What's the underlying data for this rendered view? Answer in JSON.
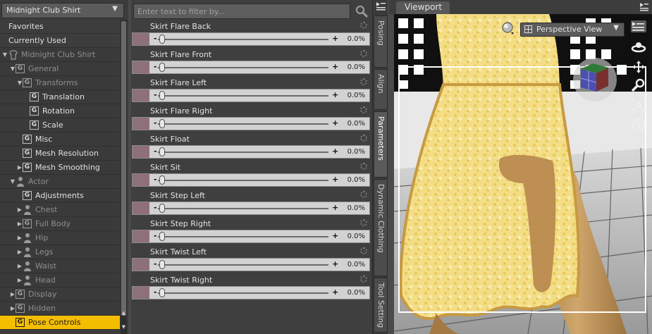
{
  "node_selector": {
    "value": "Midnight Club Shirt"
  },
  "tree": {
    "flat_items": [
      "Favorites",
      "Currently Used"
    ],
    "root": "Midnight Club Shirt",
    "items": [
      {
        "label": "General",
        "depth": 1,
        "icon": "group-icon",
        "expander": "expanded",
        "dim": true
      },
      {
        "label": "Transforms",
        "depth": 2,
        "icon": "group-icon",
        "expander": "expanded",
        "dim": true
      },
      {
        "label": "Translation",
        "depth": 3,
        "icon": "group-icon",
        "expander": "none",
        "dim": false
      },
      {
        "label": "Rotation",
        "depth": 3,
        "icon": "group-icon",
        "expander": "none",
        "dim": false
      },
      {
        "label": "Scale",
        "depth": 3,
        "icon": "group-icon",
        "expander": "none",
        "dim": false
      },
      {
        "label": "Misc",
        "depth": 2,
        "icon": "group-icon",
        "expander": "none",
        "dim": false
      },
      {
        "label": "Mesh Resolution",
        "depth": 2,
        "icon": "group-icon",
        "expander": "none",
        "dim": false
      },
      {
        "label": "Mesh Smoothing",
        "depth": 2,
        "icon": "group-icon",
        "expander": "collapsed",
        "dim": false
      },
      {
        "label": "Actor",
        "depth": 1,
        "icon": "figure-icon",
        "expander": "expanded",
        "dim": true
      },
      {
        "label": "Adjustments",
        "depth": 2,
        "icon": "group-icon",
        "expander": "none",
        "dim": false
      },
      {
        "label": "Chest",
        "depth": 2,
        "icon": "figure-icon",
        "expander": "collapsed",
        "dim": true
      },
      {
        "label": "Full Body",
        "depth": 2,
        "icon": "group-icon",
        "expander": "collapsed",
        "dim": true
      },
      {
        "label": "Hip",
        "depth": 2,
        "icon": "figure-icon",
        "expander": "collapsed",
        "dim": true
      },
      {
        "label": "Legs",
        "depth": 2,
        "icon": "figure-icon",
        "expander": "collapsed",
        "dim": true
      },
      {
        "label": "Waist",
        "depth": 2,
        "icon": "figure-icon",
        "expander": "collapsed",
        "dim": true
      },
      {
        "label": "Head",
        "depth": 2,
        "icon": "figure-icon",
        "expander": "collapsed",
        "dim": true
      },
      {
        "label": "Display",
        "depth": 1,
        "icon": "group-icon",
        "expander": "collapsed",
        "dim": true
      },
      {
        "label": "Hidden",
        "depth": 1,
        "icon": "group-icon",
        "expander": "collapsed",
        "dim": true
      },
      {
        "label": "Pose Controls",
        "depth": 1,
        "icon": "group-icon",
        "expander": "none",
        "dim": false,
        "selected": true
      }
    ]
  },
  "filter": {
    "placeholder": "Enter text to filter by..."
  },
  "parameters": [
    {
      "name": "Skirt Flare Back",
      "value": "0.0%",
      "minus": "-",
      "plus": "+"
    },
    {
      "name": "Skirt Flare Front",
      "value": "0.0%",
      "minus": "-",
      "plus": "+"
    },
    {
      "name": "Skirt Flare Left",
      "value": "0.0%",
      "minus": "-",
      "plus": "+"
    },
    {
      "name": "Skirt Flare Right",
      "value": "0.0%",
      "minus": "-",
      "plus": "+"
    },
    {
      "name": "Skirt Float",
      "value": "0.0%",
      "minus": "-",
      "plus": "+"
    },
    {
      "name": "Skirt Sit",
      "value": "0.0%",
      "minus": "-",
      "plus": "+"
    },
    {
      "name": "Skirt Step Left",
      "value": "0.0%",
      "minus": "-",
      "plus": "+"
    },
    {
      "name": "Skirt Step Right",
      "value": "0.0%",
      "minus": "-",
      "plus": "+"
    },
    {
      "name": "Skirt Twist Left",
      "value": "0.0%",
      "minus": "-",
      "plus": "+"
    },
    {
      "name": "Skirt Twist Right",
      "value": "0.0%",
      "minus": "-",
      "plus": "+"
    }
  ],
  "side_tabs": [
    {
      "label": "Posing",
      "active": false
    },
    {
      "label": "Align",
      "active": false
    },
    {
      "label": "Parameters",
      "active": true
    },
    {
      "label": "Dynamic Clothing",
      "active": false
    },
    {
      "label": "Tool Setting",
      "active": false
    }
  ],
  "viewport": {
    "tab_label": "Viewport",
    "camera": "Perspective View",
    "tools": [
      "scene-menu-icon",
      "orbit-icon",
      "pan-icon",
      "zoom-icon",
      "frame-icon",
      "reset-icon"
    ]
  },
  "colors": {
    "selection": "#f4be00",
    "panel_bg": "#3c3c3c",
    "slider_tint": "#8e6f7c",
    "skirt": "#f0d97a",
    "skin": "#c49a5c"
  }
}
